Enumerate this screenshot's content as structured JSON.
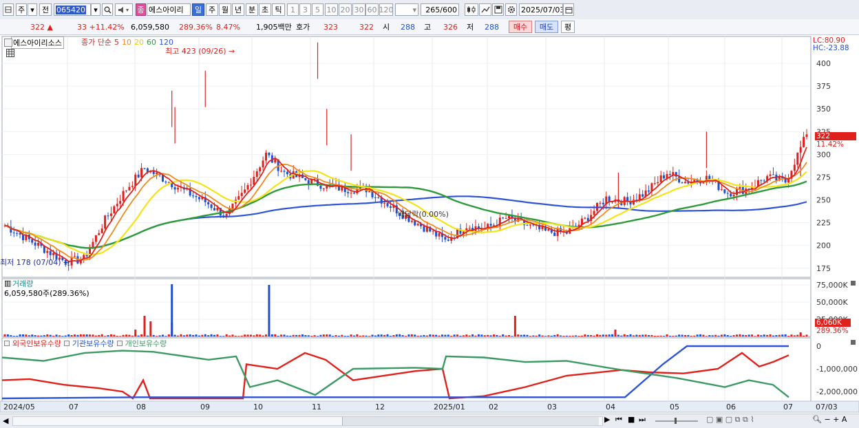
{
  "toolbar": {
    "period_label": "주",
    "market_label": "전",
    "code_value": "065420",
    "name_badge": "종",
    "name_value": "에스아이리",
    "tabs": [
      "일",
      "주",
      "월",
      "년",
      "분",
      "초",
      "틱"
    ],
    "active_tab": "일",
    "minute_buttons": [
      "1",
      "3",
      "5",
      "10",
      "20",
      "30",
      "60",
      "120"
    ],
    "count_value": "265",
    "count_total": "/600",
    "date_value": "2025/07/03"
  },
  "quote": {
    "price": "322",
    "change": "33",
    "change_pct": "+11.42%",
    "volume": "6,059,580",
    "volume_ratio": "289.36%",
    "turnover_rate": "8.47%",
    "amount": "1,905백만",
    "hoga_label": "호가",
    "ask": "323",
    "bid": "322",
    "open_label": "시",
    "open": "288",
    "high_label": "고",
    "high": "326",
    "low_label": "저",
    "low": "288",
    "buy_label": "매수",
    "sell_label": "매도",
    "avg_label": "평"
  },
  "price_panel": {
    "title": "에스아이리소스",
    "ma_label": "종가 단순",
    "ma_periods": [
      "5",
      "10",
      "20",
      "60",
      "120"
    ],
    "high_annotation": "최고 423 (09/26)",
    "low_annotation": "최저 178 (07/04)",
    "dividend_annotation": "배당락(0.00%)",
    "lc": "LC:80.90",
    "hc": "HC:-23.88",
    "current_price_tag": "322",
    "current_pct_tag": "11.42%"
  },
  "volume_panel": {
    "title": "거래량",
    "value": "6,059,580주(289.36%)",
    "current_tag": "6,060K",
    "current_pct": "289.36%"
  },
  "holding_panel": {
    "series": [
      "외국인보유수량",
      "기관보유수량",
      "개인보유수량"
    ]
  },
  "bottom": {
    "zoom_symbol": "A"
  },
  "colors": {
    "ma5": "#e0201b",
    "ma10": "#f08a1a",
    "ma20": "#f4e414",
    "ma60": "#2d9a3a",
    "ma120": "#2d52d6",
    "up": "#e0201b",
    "down": "#1d4fd0",
    "foreign": "#e0201b",
    "institution": "#2d52d6",
    "individual": "#3a9a62"
  },
  "chart_data": [
    {
      "type": "candlestick",
      "title": "에스아이리소스",
      "x": [
        "2024/05",
        "07",
        "08",
        "09",
        "10",
        "11",
        "12",
        "2025/01",
        "02",
        "03",
        "04",
        "05",
        "06",
        "07",
        "07/03"
      ],
      "ylim": [
        165,
        425
      ],
      "yticks": [
        175,
        200,
        225,
        250,
        275,
        300,
        325,
        350,
        375,
        400
      ],
      "close_series": [
        [
          "2024/05",
          222
        ],
        [
          "2024/05",
          208
        ],
        [
          "2024/06",
          196
        ],
        [
          "2024/07",
          182
        ],
        [
          "2024/07",
          185
        ],
        [
          "2024/07",
          228
        ],
        [
          "2024/08",
          262
        ],
        [
          "2024/08",
          285
        ],
        [
          "2024/08",
          272
        ],
        [
          "2024/08",
          260
        ],
        [
          "2024/09",
          248
        ],
        [
          "2024/09",
          232
        ],
        [
          "2024/09",
          260
        ],
        [
          "2024/09",
          300
        ],
        [
          "2024/09",
          280
        ],
        [
          "2024/10",
          272
        ],
        [
          "2024/10",
          265
        ],
        [
          "2024/10",
          262
        ],
        [
          "2024/11",
          262
        ],
        [
          "2024/11",
          248
        ],
        [
          "2024/11",
          232
        ],
        [
          "2024/12",
          218
        ],
        [
          "2024/12",
          205
        ],
        [
          "2024/12",
          222
        ],
        [
          "2025/01",
          218
        ],
        [
          "2025/01",
          230
        ],
        [
          "2025/01",
          222
        ],
        [
          "2025/02",
          215
        ],
        [
          "2025/02",
          214
        ],
        [
          "2025/03",
          228
        ],
        [
          "2025/03",
          252
        ],
        [
          "2025/03",
          248
        ],
        [
          "2025/04",
          258
        ],
        [
          "2025/04",
          280
        ],
        [
          "2025/04",
          270
        ],
        [
          "2025/05",
          274
        ],
        [
          "2025/05",
          258
        ],
        [
          "2025/06",
          262
        ],
        [
          "2025/06",
          275
        ],
        [
          "2025/06",
          270
        ],
        [
          "2025/07",
          322
        ]
      ]
    },
    {
      "type": "bar",
      "title": "거래량",
      "yticks": [
        "75,000K",
        "50,000K",
        "25,000K"
      ]
    },
    {
      "type": "line",
      "series": [
        {
          "name": "외국인보유수량"
        },
        {
          "name": "기관보유수량"
        },
        {
          "name": "개인보유수량"
        }
      ],
      "yticks": [
        "0",
        "-1,000,000",
        "-2,000,000"
      ]
    }
  ]
}
